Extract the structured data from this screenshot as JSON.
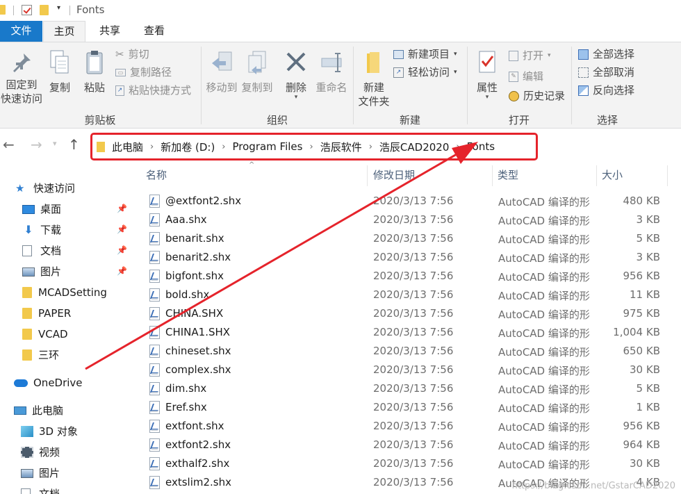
{
  "window": {
    "title": "Fonts"
  },
  "menu_tabs": [
    "文件",
    "主页",
    "共享",
    "查看"
  ],
  "ribbon": {
    "clipboard": {
      "label": "剪贴板",
      "pin": "固定到\n快速访问",
      "pin_line1": "固定到",
      "pin_line2": "快速访问",
      "copy": "复制",
      "paste": "粘贴",
      "cut": "剪切",
      "copy_path": "复制路径",
      "paste_shortcut": "粘贴快捷方式"
    },
    "organize": {
      "label": "组织",
      "move_to": "移动到",
      "copy_to": "复制到",
      "delete": "删除",
      "rename": "重命名"
    },
    "new": {
      "label": "新建",
      "new_folder_line1": "新建",
      "new_folder_line2": "文件夹",
      "new_item": "新建项目",
      "easy_access": "轻松访问"
    },
    "open": {
      "label": "打开",
      "properties": "属性",
      "open": "打开",
      "edit": "编辑",
      "history": "历史记录"
    },
    "select": {
      "label": "选择",
      "select_all": "全部选择",
      "select_none": "全部取消",
      "invert": "反向选择"
    }
  },
  "address": {
    "crumbs": [
      "此电脑",
      "新加卷 (D:)",
      "Program Files",
      "浩辰软件",
      "浩辰CAD2020",
      "Fonts"
    ]
  },
  "nav": {
    "quick_access": "快速访问",
    "desktop": "桌面",
    "downloads": "下载",
    "documents": "文档",
    "pictures": "图片",
    "folder1": "MCADSetting",
    "folder2": "PAPER",
    "folder3": "VCAD",
    "folder4": "三环",
    "onedrive": "OneDrive",
    "this_pc": "此电脑",
    "objects3d": "3D 对象",
    "videos": "视频",
    "pictures2": "图片",
    "documents2": "文档"
  },
  "columns": {
    "name": "名称",
    "date": "修改日期",
    "type": "类型",
    "size": "大小"
  },
  "files": [
    {
      "name": "@extfont2.shx",
      "date": "2020/3/13 7:56",
      "type": "AutoCAD 编译的形",
      "size": "480 KB"
    },
    {
      "name": "Aaa.shx",
      "date": "2020/3/13 7:56",
      "type": "AutoCAD 编译的形",
      "size": "3 KB"
    },
    {
      "name": "benarit.shx",
      "date": "2020/3/13 7:56",
      "type": "AutoCAD 编译的形",
      "size": "5 KB"
    },
    {
      "name": "benarit2.shx",
      "date": "2020/3/13 7:56",
      "type": "AutoCAD 编译的形",
      "size": "3 KB"
    },
    {
      "name": "bigfont.shx",
      "date": "2020/3/13 7:56",
      "type": "AutoCAD 编译的形",
      "size": "956 KB"
    },
    {
      "name": "bold.shx",
      "date": "2020/3/13 7:56",
      "type": "AutoCAD 编译的形",
      "size": "11 KB"
    },
    {
      "name": "CHINA.SHX",
      "date": "2020/3/13 7:56",
      "type": "AutoCAD 编译的形",
      "size": "975 KB"
    },
    {
      "name": "CHINA1.SHX",
      "date": "2020/3/13 7:56",
      "type": "AutoCAD 编译的形",
      "size": "1,004 KB"
    },
    {
      "name": "chineset.shx",
      "date": "2020/3/13 7:56",
      "type": "AutoCAD 编译的形",
      "size": "650 KB"
    },
    {
      "name": "complex.shx",
      "date": "2020/3/13 7:56",
      "type": "AutoCAD 编译的形",
      "size": "30 KB"
    },
    {
      "name": "dim.shx",
      "date": "2020/3/13 7:56",
      "type": "AutoCAD 编译的形",
      "size": "5 KB"
    },
    {
      "name": "Eref.shx",
      "date": "2020/3/13 7:56",
      "type": "AutoCAD 编译的形",
      "size": "1 KB"
    },
    {
      "name": "extfont.shx",
      "date": "2020/3/13 7:56",
      "type": "AutoCAD 编译的形",
      "size": "956 KB"
    },
    {
      "name": "extfont2.shx",
      "date": "2020/3/13 7:56",
      "type": "AutoCAD 编译的形",
      "size": "964 KB"
    },
    {
      "name": "exthalf2.shx",
      "date": "2020/3/13 7:56",
      "type": "AutoCAD 编译的形",
      "size": "30 KB"
    },
    {
      "name": "extslim2.shx",
      "date": "2020/3/13 7:56",
      "type": "AutoCAD 编译的形",
      "size": "4 KB"
    }
  ],
  "watermark": "https://blog.csdn.net/GstarCAD2020",
  "colors": {
    "accent": "#1979ca",
    "highlight_red": "#e5232b",
    "folder": "#f2c94c"
  }
}
